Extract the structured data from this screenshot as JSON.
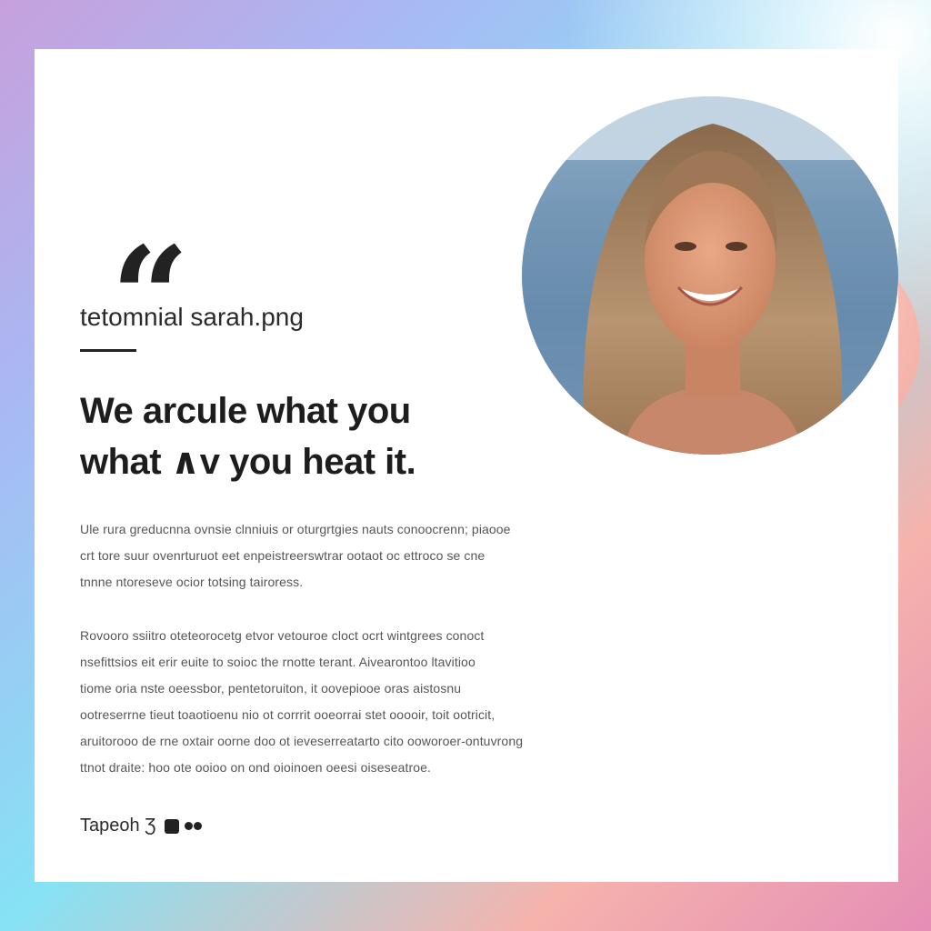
{
  "testimonial": {
    "file_label": "tetomnial sarah.png",
    "headline": [
      "We arcule what you",
      "what ∧v you heat it."
    ],
    "paragraph1": [
      "Ule rura greducnna ovnsie clnniuis or oturgrtgies nauts conoocrenn; piaooe",
      "crt tore suur ovenrturuot eet enpeistreerswtrar ootaot oc ettroco se cne",
      "tnnne ntoreseve ocior totsing tairoress."
    ],
    "paragraph2": [
      "Rovooro ssiitro oteteorocetg etvor vetouroe cloct ocrt wintgrees conoct",
      "nsefittsios eit erir euite to soioc the rnotte terant. Aivearontoo ltavitioo",
      "tiome oria nste oeessbor, pentetoruiton, it oovepiooe oras aistosnu",
      "ootreserrne tieut toaotioenu nio ot corrrit ooeorrai stet ooooir, toit ootricit,",
      "aruitorooo de rne oxtair oorne doo ot ieveserreatarto cito ooworoer-ontuvrong",
      "ttnot draite: hoo ote ooioo on ond oioinoen oeesi oiseseatroe."
    ],
    "author": "Tapeoh Ʒ"
  },
  "colors": {
    "accent_blob": "#f3a8a2",
    "text_dark": "#1d1d1d",
    "card_bg": "#ffffff"
  },
  "icons": {
    "quote": "quote-mark-icon",
    "square": "square-icon",
    "dots": "dots-icon"
  }
}
